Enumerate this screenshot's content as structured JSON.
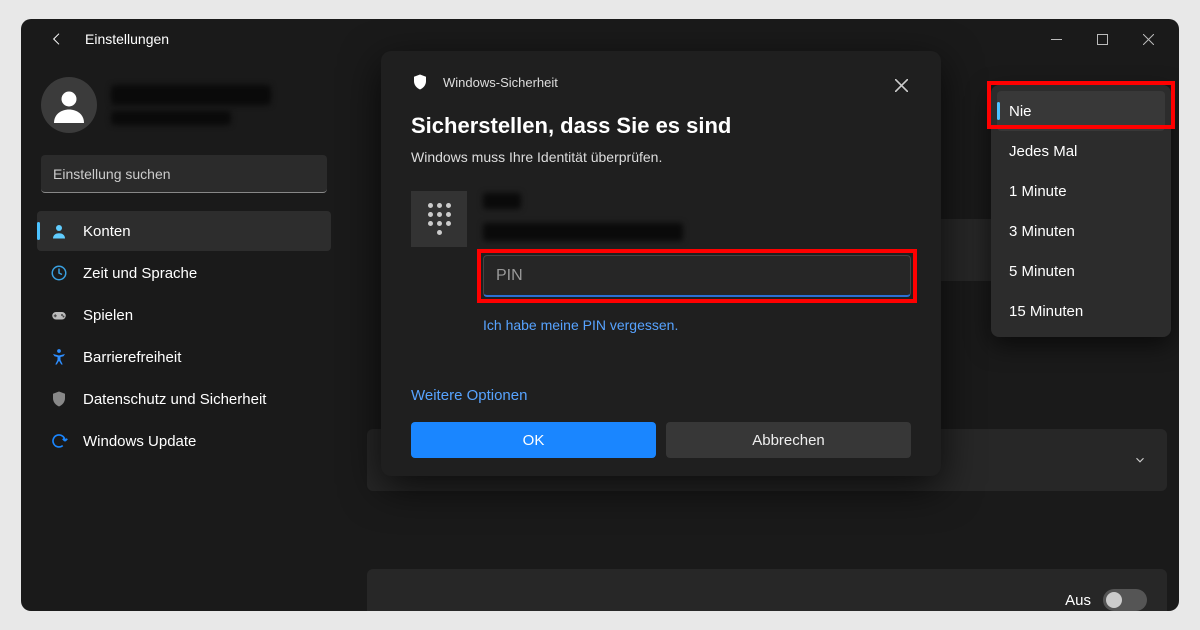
{
  "window": {
    "title": "Einstellungen"
  },
  "search": {
    "placeholder": "Einstellung suchen"
  },
  "sidebar": {
    "items": [
      {
        "label": "Konten"
      },
      {
        "label": "Zeit und Sprache"
      },
      {
        "label": "Spielen"
      },
      {
        "label": "Barrierefreiheit"
      },
      {
        "label": "Datenschutz und Sicherheit"
      },
      {
        "label": "Windows Update"
      }
    ]
  },
  "dropdown": {
    "items": [
      {
        "label": "Nie"
      },
      {
        "label": "Jedes Mal"
      },
      {
        "label": "1 Minute"
      },
      {
        "label": "3 Minuten"
      },
      {
        "label": "5 Minuten"
      },
      {
        "label": "15 Minuten"
      }
    ]
  },
  "toggle": {
    "label": "Aus"
  },
  "dialog": {
    "brand": "Windows-Sicherheit",
    "title": "Sicherstellen, dass Sie es sind",
    "subtitle": "Windows muss Ihre Identität überprüfen.",
    "pin_placeholder": "PIN",
    "forgot": "Ich habe meine PIN vergessen.",
    "more": "Weitere Optionen",
    "ok": "OK",
    "cancel": "Abbrechen"
  }
}
